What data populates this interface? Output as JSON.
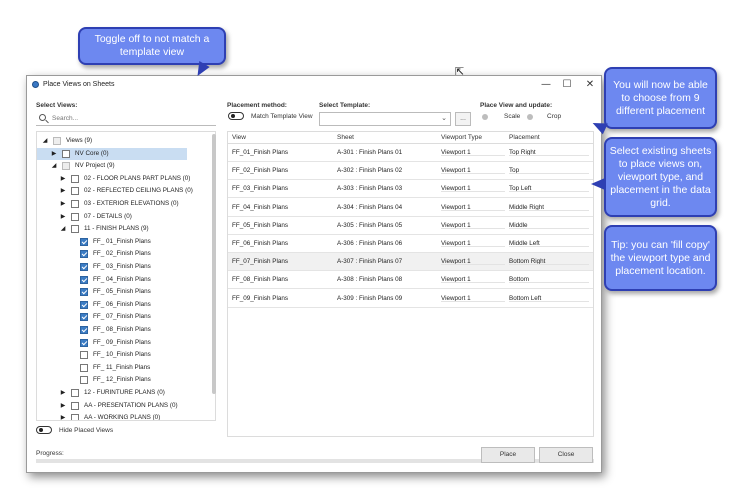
{
  "window": {
    "title": "Place Views on Sheets",
    "minimize": "—",
    "maximize": "☐",
    "close": "✕"
  },
  "left": {
    "select_views_label": "Select Views:",
    "search_placeholder": "Search...",
    "tree": [
      {
        "indent": 0,
        "chev": "◢",
        "cb": "dim",
        "label": "Views (9)"
      },
      {
        "indent": 1,
        "chev": "▶",
        "cb": "empty",
        "label": "NV Core (0)",
        "selected": true
      },
      {
        "indent": 1,
        "chev": "◢",
        "cb": "dim",
        "label": "NV Project (9)"
      },
      {
        "indent": 2,
        "chev": "▶",
        "cb": "empty",
        "label": "02 - FLOOR PLANS PART PLANS (0)"
      },
      {
        "indent": 2,
        "chev": "▶",
        "cb": "empty",
        "label": "02 - REFLECTED CEILING PLANS (0)"
      },
      {
        "indent": 2,
        "chev": "▶",
        "cb": "empty",
        "label": "03 - EXTERIOR ELEVATIONS (0)"
      },
      {
        "indent": 2,
        "chev": "▶",
        "cb": "empty",
        "label": "07 - DETAILS (0)"
      },
      {
        "indent": 2,
        "chev": "◢",
        "cb": "empty",
        "label": "11 - FINISH PLANS (9)"
      },
      {
        "indent": 3,
        "chev": "",
        "cb": "checked",
        "label": "FF_ 01_Finish Plans"
      },
      {
        "indent": 3,
        "chev": "",
        "cb": "checked",
        "label": "FF_ 02_Finish Plans"
      },
      {
        "indent": 3,
        "chev": "",
        "cb": "checked",
        "label": "FF_ 03_Finish Plans"
      },
      {
        "indent": 3,
        "chev": "",
        "cb": "checked",
        "label": "FF_ 04_Finish Plans"
      },
      {
        "indent": 3,
        "chev": "",
        "cb": "checked",
        "label": "FF_ 05_Finish Plans"
      },
      {
        "indent": 3,
        "chev": "",
        "cb": "checked",
        "label": "FF_ 06_Finish Plans"
      },
      {
        "indent": 3,
        "chev": "",
        "cb": "checked",
        "label": "FF_ 07_Finish Plans"
      },
      {
        "indent": 3,
        "chev": "",
        "cb": "checked",
        "label": "FF_ 08_Finish Plans"
      },
      {
        "indent": 3,
        "chev": "",
        "cb": "checked",
        "label": "FF_ 09_Finish Plans"
      },
      {
        "indent": 3,
        "chev": "",
        "cb": "empty",
        "label": "FF_ 10_Finish Plans"
      },
      {
        "indent": 3,
        "chev": "",
        "cb": "empty",
        "label": "FF_ 11_Finish Plans"
      },
      {
        "indent": 3,
        "chev": "",
        "cb": "empty",
        "label": "FF_ 12_Finish Plans"
      },
      {
        "indent": 2,
        "chev": "▶",
        "cb": "empty",
        "label": "12 - FURINTURE PLANS (0)"
      },
      {
        "indent": 2,
        "chev": "▶",
        "cb": "empty",
        "label": "AA - PRESENTATION PLANS (0)"
      },
      {
        "indent": 2,
        "chev": "▶",
        "cb": "empty",
        "label": "AA - WORKING PLANS (0)"
      }
    ],
    "hide_placed_label": "Hide Placed Views"
  },
  "placement": {
    "method_label": "Placement method:",
    "toggle_label": "Match Template View"
  },
  "template": {
    "label": "Select Template:",
    "value": "",
    "more": "..."
  },
  "update": {
    "label": "Place View and update:",
    "scale": "Scale",
    "crop": "Crop"
  },
  "grid": {
    "headers": [
      "View",
      "Sheet",
      "Viewport Type",
      "Placement"
    ],
    "rows": [
      [
        "FF_01_Finish Plans",
        "A-301 : Finish Plans 01",
        "Viewport 1",
        "Top Right"
      ],
      [
        "FF_02_Finish Plans",
        "A-302 : Finish Plans 02",
        "Viewport 1",
        "Top"
      ],
      [
        "FF_03_Finish Plans",
        "A-303 : Finish Plans 03",
        "Viewport 1",
        "Top Left"
      ],
      [
        "FF_04_Finish Plans",
        "A-304 : Finish Plans 04",
        "Viewport 1",
        "Middle Right"
      ],
      [
        "FF_05_Finish Plans",
        "A-305 : Finish Plans 05",
        "Viewport 1",
        "Middle"
      ],
      [
        "FF_06_Finish Plans",
        "A-306 : Finish Plans 06",
        "Viewport 1",
        "Middle Left"
      ],
      [
        "FF_07_Finish Plans",
        "A-307 : Finish Plans 07",
        "Viewport 1",
        "Bottom Right"
      ],
      [
        "FF_08_Finish Plans",
        "A-308 : Finish Plans 08",
        "Viewport 1",
        "Bottom"
      ],
      [
        "FF_09_Finish Plans",
        "A-309 : Finish Plans 09",
        "Viewport 1",
        "Bottom Left"
      ]
    ]
  },
  "footer": {
    "progress_label": "Progress:",
    "place": "Place",
    "close": "Close"
  },
  "callouts": {
    "toggle": "Toggle off to not match a template view",
    "placement": "You will now be able to choose from 9 different placement",
    "sheets": "Select existing sheets to place views on, viewport type, and placement in the data grid.",
    "tip": "Tip: you can 'fill copy' the viewport type and placement location."
  },
  "colors": {
    "callout_fill": "#6d88f0",
    "callout_border": "#2e3fb3",
    "selection": "#c9ddf2",
    "checkbox": "#3b7cc4"
  }
}
